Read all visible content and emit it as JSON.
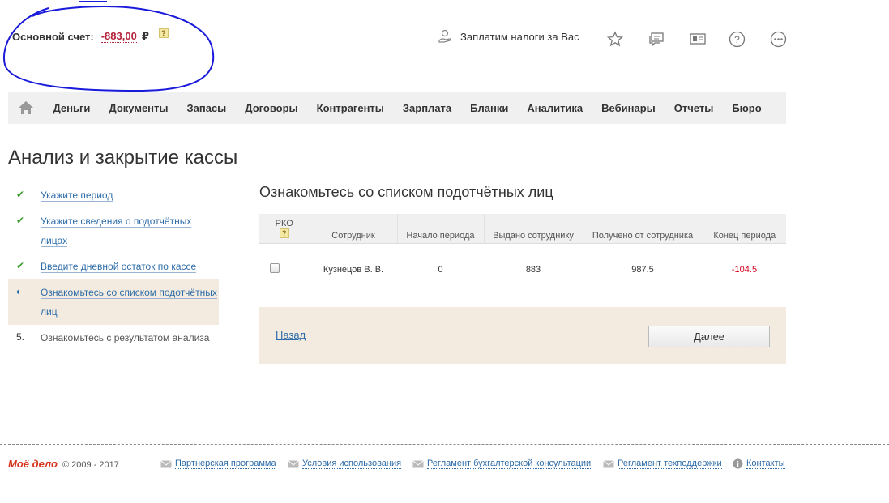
{
  "account": {
    "label": "Основной счет:",
    "amount": "-883,00",
    "currency": "₽",
    "help": "?"
  },
  "header": {
    "taxes_label": "Заплатим налоги за Вас"
  },
  "nav": {
    "items": [
      "Деньги",
      "Документы",
      "Запасы",
      "Договоры",
      "Контрагенты",
      "Зарплата",
      "Бланки",
      "Аналитика",
      "Вебинары",
      "Отчеты",
      "Бюро"
    ]
  },
  "page_title": "Анализ и закрытие кассы",
  "steps": [
    {
      "mark": "✔",
      "label": "Укажите период"
    },
    {
      "mark": "✔",
      "label": "Укажите сведения о подотчётных лицах"
    },
    {
      "mark": "✔",
      "label": "Введите дневной остаток по кассе"
    },
    {
      "mark": "♦",
      "label": "Ознакомьтесь со списком подотчётных лиц"
    },
    {
      "mark": "5.",
      "label": "Ознакомьтесь с результатом анализа"
    }
  ],
  "section_title": "Ознакомьтесь со списком подотчётных лиц",
  "table": {
    "headers": {
      "rko": "РКО",
      "rko_help": "?",
      "employee": "Сотрудник",
      "start": "Начало периода",
      "issued": "Выдано сотруднику",
      "received": "Получено от сотрудника",
      "end": "Конец периода"
    },
    "rows": [
      {
        "employee": "Кузнецов В. В.",
        "start": "0",
        "issued": "883",
        "received": "987.5",
        "end": "-104.5"
      }
    ]
  },
  "actions": {
    "back": "Назад",
    "next": "Далее"
  },
  "footer": {
    "logo": "Моё дело",
    "copyright": "© 2009 - 2017",
    "links": [
      "Партнерская программа",
      "Условия использования",
      "Регламент бухгалтерской консультации",
      "Регламент техподдержки",
      "Контакты"
    ]
  }
}
